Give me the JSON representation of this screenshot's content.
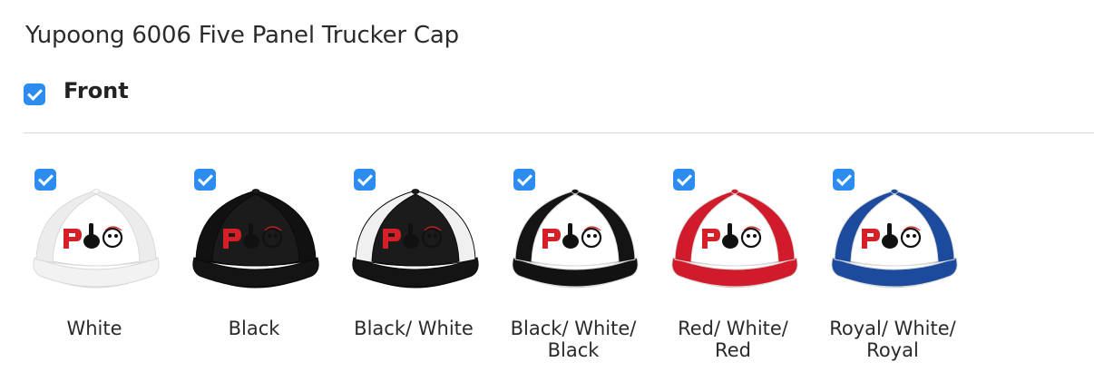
{
  "product": {
    "title": "Yupoong 6006 Five Panel Trucker Cap"
  },
  "placement": {
    "label": "Front",
    "checked": true
  },
  "colors": [
    {
      "name": "White",
      "checked": true,
      "crown": "#f7f7f7",
      "mesh": "#ececec",
      "brim": "#f2f2f2",
      "front": "#ffffff"
    },
    {
      "name": "Black",
      "checked": true,
      "crown": "#1b1b1b",
      "mesh": "#111111",
      "brim": "#141414",
      "front": "#1b1b1b"
    },
    {
      "name": "Black/ White",
      "checked": true,
      "crown": "#1b1b1b",
      "mesh": "#f0f0f0",
      "brim": "#141414",
      "front": "#1b1b1b"
    },
    {
      "name": "Black/ White/ Black",
      "checked": true,
      "crown": "#ffffff",
      "mesh": "#141414",
      "brim": "#121212",
      "front": "#ffffff"
    },
    {
      "name": "Red/ White/ Red",
      "checked": true,
      "crown": "#ffffff",
      "mesh": "#d11a2a",
      "brim": "#d11a2a",
      "front": "#ffffff"
    },
    {
      "name": "Royal/ White/ Royal",
      "checked": true,
      "crown": "#ffffff",
      "mesh": "#1c4a9c",
      "brim": "#1c4a9c",
      "front": "#ffffff"
    }
  ],
  "logo": {
    "letter": "P",
    "letter_color": "#d61f26",
    "glyph_color": "#111111"
  }
}
